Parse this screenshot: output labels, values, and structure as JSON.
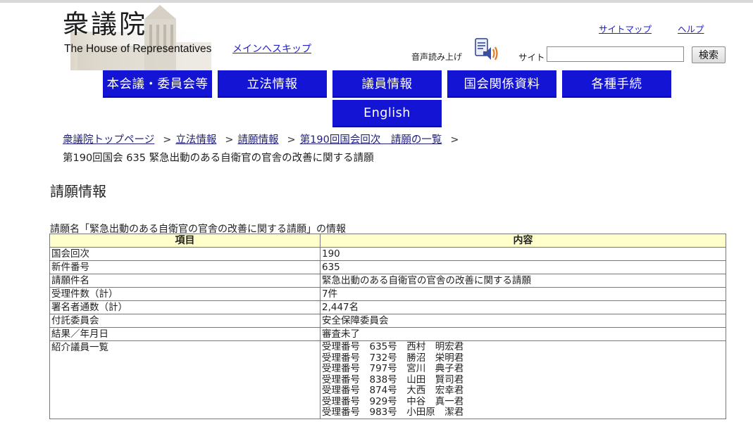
{
  "header": {
    "logo_kanji": "衆議院",
    "logo_english": "The House of Representatives",
    "skip_link": "メインへスキップ",
    "sitemap": "サイトマップ",
    "help": "ヘルプ",
    "voice_label": "音声読み上げ",
    "site_label": "サイト",
    "search_placeholder": "",
    "search_button": "検索"
  },
  "nav": {
    "items": [
      "本会議・委員会等",
      "立法情報",
      "議員情報",
      "国会関係資料",
      "各種手続"
    ],
    "english": "English"
  },
  "breadcrumb": {
    "links": [
      "衆議院トップページ",
      "立法情報",
      "請願情報",
      "第190回国会回次　請願の一覧"
    ],
    "separator": ">",
    "current": "第190回国会 635 緊急出動のある自衛官の官舎の改善に関する請願"
  },
  "page": {
    "title": "請願情報",
    "caption": "請願名「緊急出動のある自衛官の官舎の改善に関する請願」の情報"
  },
  "table": {
    "headers": [
      "項目",
      "内容"
    ],
    "rows": [
      {
        "label": "国会回次",
        "value": "190"
      },
      {
        "label": "新件番号",
        "value": "635"
      },
      {
        "label": "請願件名",
        "value": "緊急出動のある自衛官の官舎の改善に関する請願"
      },
      {
        "label": "受理件数（計）",
        "value": "7件"
      },
      {
        "label": "署名者通数（計）",
        "value": "2,447名"
      },
      {
        "label": "付託委員会",
        "value": "安全保障委員会"
      },
      {
        "label": "結果／年月日",
        "value": "審査未了"
      }
    ],
    "introducers_label": "紹介議員一覧",
    "introducers": [
      "受理番号　635号　西村　明宏君",
      "受理番号　732号　勝沼　栄明君",
      "受理番号　797号　宮川　典子君",
      "受理番号　838号　山田　賢司君",
      "受理番号　874号　大西　宏幸君",
      "受理番号　929号　中谷　真一君",
      "受理番号　983号　小田原　潔君"
    ]
  },
  "colors": {
    "nav_blue": "#1414d4",
    "header_row": "#ffffcc",
    "link": "#2020cc"
  }
}
